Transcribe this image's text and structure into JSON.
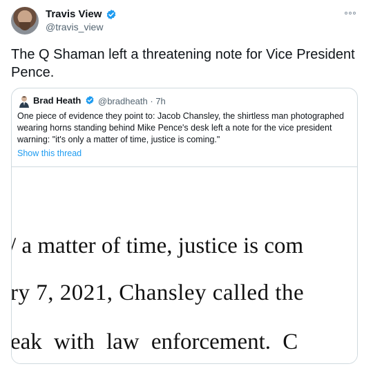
{
  "author": {
    "name": "Travis View",
    "handle": "@travis_view",
    "verified": true,
    "avatar_icon": "profile-photo"
  },
  "tweet": {
    "text": "The Q Shaman left a threatening note for Vice President Pence."
  },
  "quoted_tweet": {
    "name": "Brad Heath",
    "handle": "@bradheath",
    "time": "· 7h",
    "verified": true,
    "text": "One piece of evidence they point to: Jacob Chansley, the shirtless man photographed wearing horns standing behind Mike Pence's desk left a note for the vice president warning: \"it's only a matter of time, justice is coming.\"",
    "show_thread": "Show this thread",
    "image_lines": [
      "/ a matter of time, justice is com",
      "ry 7, 2021, Chansley called the",
      "eak with law enforcement.  C"
    ]
  },
  "colors": {
    "verified_blue": "#1d9bf0",
    "link_blue": "#1d9bf0",
    "secondary_text": "#536471",
    "border": "#cfd9de"
  }
}
